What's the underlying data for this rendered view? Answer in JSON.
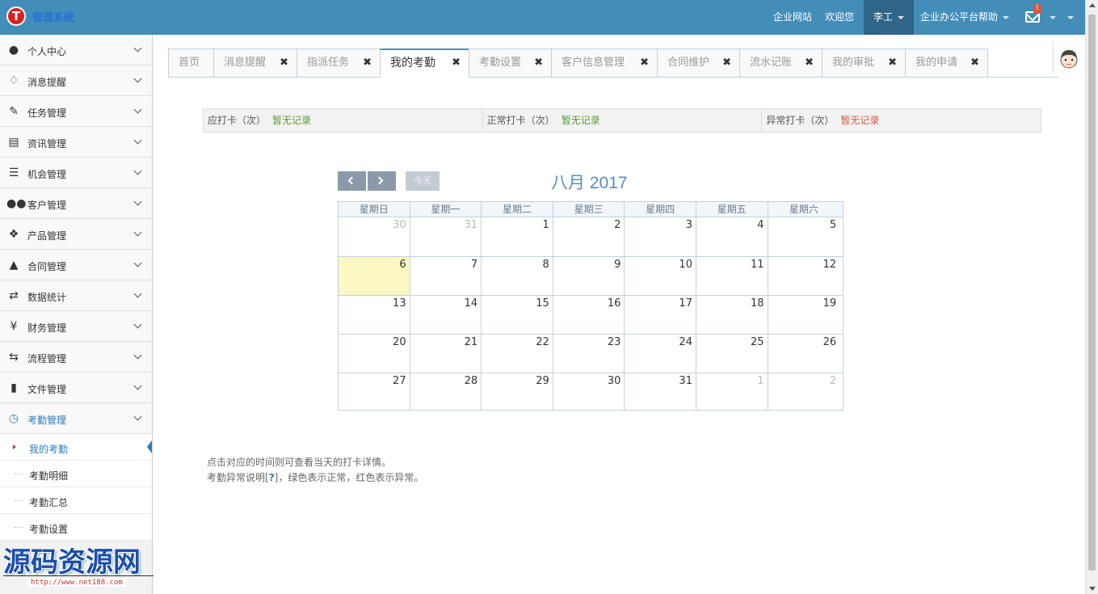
{
  "app": {
    "logo_letter": "T",
    "logo_text": "管理系统"
  },
  "topbar": {
    "links": [
      "企业网站",
      "欢迎您"
    ],
    "user_name": "李工",
    "help_label": "企业办公平台帮助",
    "mail_badge": "!"
  },
  "sidebar": {
    "items": [
      {
        "label": "个人中心",
        "icon": "user-icon"
      },
      {
        "label": "消息提醒",
        "icon": "bell-icon"
      },
      {
        "label": "任务管理",
        "icon": "edit-icon"
      },
      {
        "label": "资讯管理",
        "icon": "document-icon"
      },
      {
        "label": "机会管理",
        "icon": "list-icon"
      },
      {
        "label": "客户管理",
        "icon": "users-icon"
      },
      {
        "label": "产品管理",
        "icon": "dropbox-icon"
      },
      {
        "label": "合同管理",
        "icon": "folder-open-icon"
      },
      {
        "label": "数据统计",
        "icon": "random-icon"
      },
      {
        "label": "财务管理",
        "icon": "yen-icon"
      },
      {
        "label": "流程管理",
        "icon": "retweet-icon"
      },
      {
        "label": "文件管理",
        "icon": "file-icon"
      },
      {
        "label": "考勤管理",
        "icon": "clock-icon"
      }
    ],
    "submenu": [
      "我的考勤",
      "考勤明细",
      "考勤汇总",
      "考勤设置"
    ]
  },
  "watermark": {
    "text": "源码资源网",
    "url": "http://www.net188.com"
  },
  "tabs": [
    {
      "label": "首页",
      "closable": false
    },
    {
      "label": "消息提醒",
      "closable": true
    },
    {
      "label": "指派任务",
      "closable": true
    },
    {
      "label": "我的考勤",
      "closable": true,
      "active": true
    },
    {
      "label": "考勤设置",
      "closable": true
    },
    {
      "label": "客户信息管理",
      "closable": true
    },
    {
      "label": "合同维护",
      "closable": true
    },
    {
      "label": "流水记账",
      "closable": true
    },
    {
      "label": "我的审批",
      "closable": true
    },
    {
      "label": "我的申请",
      "closable": true
    }
  ],
  "stats": [
    {
      "label": "应打卡（次）",
      "value": "暂无记录",
      "color": "#5b9a2e"
    },
    {
      "label": "正常打卡（次）",
      "value": "暂无记录",
      "color": "#5b9a2e"
    },
    {
      "label": "异常打卡（次）",
      "value": "暂无记录",
      "color": "#d15b47"
    }
  ],
  "calendar": {
    "today_label": "今天",
    "title": "八月 2017",
    "weekdays": [
      "星期日",
      "星期一",
      "星期二",
      "星期三",
      "星期四",
      "星期五",
      "星期六"
    ],
    "weeks": [
      [
        "30",
        "31",
        "1",
        "2",
        "3",
        "4",
        "5"
      ],
      [
        "6",
        "7",
        "8",
        "9",
        "10",
        "11",
        "12"
      ],
      [
        "13",
        "14",
        "15",
        "16",
        "17",
        "18",
        "19"
      ],
      [
        "20",
        "21",
        "22",
        "23",
        "24",
        "25",
        "26"
      ],
      [
        "27",
        "28",
        "29",
        "30",
        "31",
        "1",
        "2"
      ]
    ],
    "today": "6"
  },
  "notes": {
    "line1": "点击对应的时间则可查看当天的打卡详情。",
    "line2_prefix": "考勤异常说明[",
    "line2_q": "?",
    "line2_suffix": "]，绿色表示正常，红色表示异常。"
  }
}
